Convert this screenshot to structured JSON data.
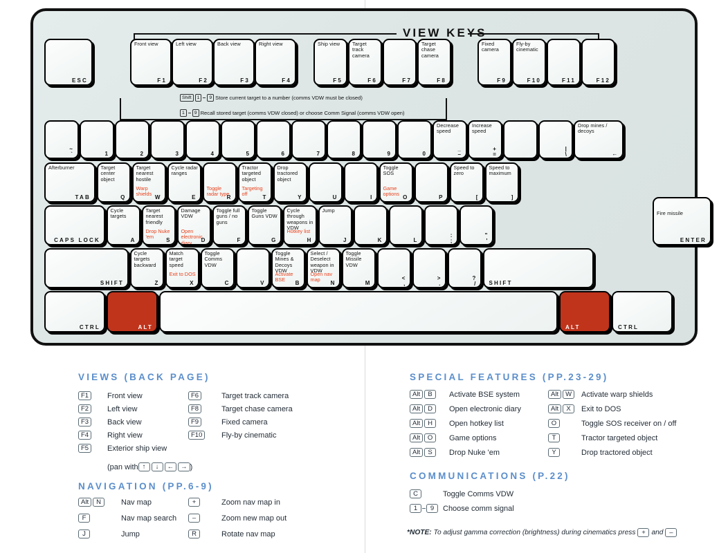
{
  "card": {
    "view_keys_title": "VIEW KEYS",
    "annotations": [
      {
        "keys": [
          "Shift",
          "1",
          "9"
        ],
        "text": "Store current target to a number (comms VDW must be closed)"
      },
      {
        "keys": [
          "1",
          "9"
        ],
        "text": "Recall stored target (comms VDW closed) or choose Comm Signal (comms VDW open)"
      }
    ]
  },
  "keyboard": {
    "function_row": [
      {
        "cap": "ESC",
        "fn": ""
      },
      {
        "cap": "F1",
        "fn": "Front view"
      },
      {
        "cap": "F2",
        "fn": "Left view"
      },
      {
        "cap": "F3",
        "fn": "Back view"
      },
      {
        "cap": "F4",
        "fn": "Right view"
      },
      {
        "cap": "F5",
        "fn": "Ship view"
      },
      {
        "cap": "F6",
        "fn": "Target track camera"
      },
      {
        "cap": "F7",
        "fn": ""
      },
      {
        "cap": "F8",
        "fn": "Target chase camera"
      },
      {
        "cap": "F9",
        "fn": "Fixed camera"
      },
      {
        "cap": "F10",
        "fn": "Fly-by cinematic"
      },
      {
        "cap": "F11",
        "fn": ""
      },
      {
        "cap": "F12",
        "fn": ""
      }
    ],
    "number_row": [
      {
        "cap": "~\n`",
        "fn": ""
      },
      {
        "cap": "1",
        "fn": ""
      },
      {
        "cap": "2",
        "fn": ""
      },
      {
        "cap": "3",
        "fn": ""
      },
      {
        "cap": "4",
        "fn": ""
      },
      {
        "cap": "5",
        "fn": ""
      },
      {
        "cap": "6",
        "fn": ""
      },
      {
        "cap": "7",
        "fn": ""
      },
      {
        "cap": "8",
        "fn": ""
      },
      {
        "cap": "9",
        "fn": ""
      },
      {
        "cap": "0",
        "fn": ""
      },
      {
        "cap": "_\n–",
        "fn": "Decrease speed"
      },
      {
        "cap": "+\n=",
        "fn": "Increase speed"
      },
      {
        "cap": "",
        "fn": ""
      },
      {
        "cap": "|\n\\",
        "fn": ""
      },
      {
        "cap": "←",
        "fn": "Drop mines / decoys"
      }
    ],
    "tab_row": [
      {
        "cap": "TAB",
        "fn": "Afterburner",
        "alt": ""
      },
      {
        "cap": "Q",
        "fn": "Target center object",
        "alt": ""
      },
      {
        "cap": "W",
        "fn": "Target nearest hostile",
        "alt": "Warp shields"
      },
      {
        "cap": "E",
        "fn": "Cycle radar ranges",
        "alt": ""
      },
      {
        "cap": "R",
        "fn": "",
        "alt": "Toggle radar type"
      },
      {
        "cap": "T",
        "fn": "Tractor targeted object",
        "alt": "Targeting off"
      },
      {
        "cap": "Y",
        "fn": "Drop tractored object",
        "alt": ""
      },
      {
        "cap": "U",
        "fn": "",
        "alt": ""
      },
      {
        "cap": "I",
        "fn": "",
        "alt": ""
      },
      {
        "cap": "O",
        "fn": "Toggle SOS",
        "alt": "Game options"
      },
      {
        "cap": "P",
        "fn": "",
        "alt": ""
      },
      {
        "cap": "[",
        "fn": "Speed to zero",
        "alt": ""
      },
      {
        "cap": "]",
        "fn": "Speed to maximum",
        "alt": ""
      }
    ],
    "caps_row": [
      {
        "cap": "CAPS LOCK",
        "fn": "",
        "alt": ""
      },
      {
        "cap": "A",
        "fn": "Cycle targets",
        "alt": ""
      },
      {
        "cap": "S",
        "fn": "Target nearest friendly",
        "alt": "Drop Nuke 'em"
      },
      {
        "cap": "D",
        "fn": "Damage VDW",
        "alt": "Open electronic diary"
      },
      {
        "cap": "F",
        "fn": "Toggle full guns / no guns",
        "alt": ""
      },
      {
        "cap": "G",
        "fn": "Toggle Guns VDW",
        "alt": ""
      },
      {
        "cap": "H",
        "fn": "Cycle through weapons in VDW",
        "alt": "Hotkey list"
      },
      {
        "cap": "J",
        "fn": "Jump",
        "alt": ""
      },
      {
        "cap": "K",
        "fn": "",
        "alt": ""
      },
      {
        "cap": "L",
        "fn": "",
        "alt": ""
      },
      {
        "cap": ":\n;",
        "fn": "",
        "alt": ""
      },
      {
        "cap": "\"\n'",
        "fn": "",
        "alt": ""
      },
      {
        "cap": "ENTER",
        "fn": "Fire missile",
        "alt": ""
      }
    ],
    "shift_row": [
      {
        "cap": "SHIFT",
        "fn": "",
        "alt": ""
      },
      {
        "cap": "Z",
        "fn": "Cycle targets backward",
        "alt": ""
      },
      {
        "cap": "X",
        "fn": "Match target speed",
        "alt": "Exit to DOS"
      },
      {
        "cap": "C",
        "fn": "Toggle Comms VDW",
        "alt": ""
      },
      {
        "cap": "V",
        "fn": "",
        "alt": ""
      },
      {
        "cap": "B",
        "fn": "Toggle Mines & Decoys VDW",
        "alt": "Activate BSE"
      },
      {
        "cap": "N",
        "fn": "Select / Deselect weapon in VDW",
        "alt": "Open nav map"
      },
      {
        "cap": "M",
        "fn": "Toggle Missile VDW",
        "alt": ""
      },
      {
        "cap": "<\n,",
        "fn": "",
        "alt": ""
      },
      {
        "cap": ">\n.",
        "fn": "",
        "alt": ""
      },
      {
        "cap": "?\n/",
        "fn": "",
        "alt": ""
      },
      {
        "cap": "SHIFT",
        "fn": "",
        "alt": ""
      }
    ],
    "bottom_row": [
      {
        "cap": "CTRL",
        "fn": "",
        "red": false
      },
      {
        "cap": "ALT",
        "fn": "",
        "red": true
      },
      {
        "cap": "",
        "fn": "",
        "red": false
      },
      {
        "cap": "ALT",
        "fn": "",
        "red": true
      },
      {
        "cap": "CTRL",
        "fn": "",
        "red": false
      }
    ]
  },
  "legend": {
    "views": {
      "title": "VIEWS (BACK PAGE)",
      "left": [
        {
          "keys": [
            "F1"
          ],
          "text": "Front view"
        },
        {
          "keys": [
            "F2"
          ],
          "text": "Left view"
        },
        {
          "keys": [
            "F3"
          ],
          "text": "Back view"
        },
        {
          "keys": [
            "F4"
          ],
          "text": "Right view"
        },
        {
          "keys": [
            "F5"
          ],
          "text": "Exterior ship view"
        }
      ],
      "sub_line": "(pan with",
      "sub_keys": [
        "↑",
        "↓",
        "←",
        "→"
      ],
      "sub_close": ")",
      "right": [
        {
          "keys": [
            "F6"
          ],
          "text": "Target track camera"
        },
        {
          "keys": [
            "F8"
          ],
          "text": "Target chase camera"
        },
        {
          "keys": [
            "F9"
          ],
          "text": "Fixed camera"
        },
        {
          "keys": [
            "F10"
          ],
          "text": "Fly-by cinematic"
        }
      ]
    },
    "navigation": {
      "title": "NAVIGATION (PP.6-9)",
      "left": [
        {
          "keys": [
            "Alt",
            "N"
          ],
          "text": "Nav map"
        },
        {
          "keys": [
            "F"
          ],
          "text": "Nav map search"
        },
        {
          "keys": [
            "J"
          ],
          "text": "Jump"
        }
      ],
      "right": [
        {
          "keys": [
            "+"
          ],
          "text": "Zoom nav map in"
        },
        {
          "keys": [
            "–"
          ],
          "text": "Zoom new map out"
        },
        {
          "keys": [
            "R"
          ],
          "text": "Rotate nav map"
        }
      ]
    },
    "special": {
      "title": "SPECIAL FEATURES (PP.23-29)",
      "left": [
        {
          "keys": [
            "Alt",
            "B"
          ],
          "text": "Activate BSE system"
        },
        {
          "keys": [
            "Alt",
            "D"
          ],
          "text": "Open electronic diary"
        },
        {
          "keys": [
            "Alt",
            "H"
          ],
          "text": "Open hotkey list"
        },
        {
          "keys": [
            "Alt",
            "O"
          ],
          "text": "Game options"
        },
        {
          "keys": [
            "Alt",
            "S"
          ],
          "text": "Drop Nuke 'em"
        }
      ],
      "right": [
        {
          "keys": [
            "Alt",
            "W"
          ],
          "text": "Activate warp shields"
        },
        {
          "keys": [
            "Alt",
            "X"
          ],
          "text": "Exit to DOS"
        },
        {
          "keys": [
            "O"
          ],
          "text": "Toggle SOS receiver on / off"
        },
        {
          "keys": [
            "T"
          ],
          "text": "Tractor targeted object"
        },
        {
          "keys": [
            "Y"
          ],
          "text": "Drop tractored object"
        }
      ]
    },
    "communications": {
      "title": "COMMUNICATIONS (P.22)",
      "rows": [
        {
          "keys": [
            "C"
          ],
          "text": "Toggle Comms VDW"
        },
        {
          "keys": [
            "1",
            "9"
          ],
          "text": "Choose comm signal"
        }
      ]
    },
    "note": {
      "label": "*NOTE:",
      "text_before": "To adjust gamma correction (brightness) during cinematics press",
      "key1": "+",
      "middle": "and",
      "key2": "–"
    }
  },
  "colors": {
    "accent_blue": "#5b8ecb",
    "alt_red": "#e8401c",
    "key_red": "#c0341c",
    "card_bg": "#dde6e5"
  }
}
